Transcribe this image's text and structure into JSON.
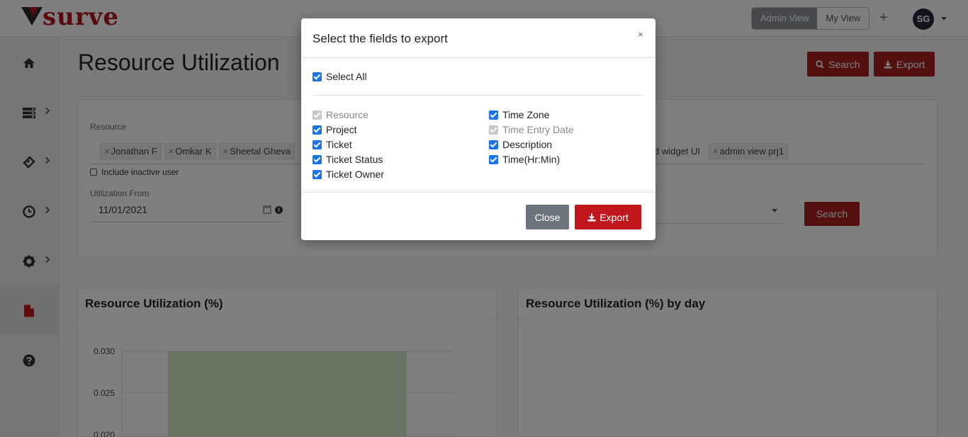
{
  "header": {
    "logo_text": "surve",
    "view_toggle": {
      "admin": "Admin View",
      "my": "My View"
    },
    "plus": "+",
    "avatar_initials": "SG"
  },
  "page": {
    "title": "Resource Utilization",
    "search_label": "Search",
    "export_label": "Export"
  },
  "filters": {
    "resource_label": "Resource",
    "resource_chips": [
      "Jonathan F",
      "Omkar K",
      "Sheetal Gheva"
    ],
    "project_chips": [
      "d widget UI",
      "admin view prj1"
    ],
    "include_inactive_label": "Include inactive user",
    "utilization_from_label": "Utilization From",
    "utilization_from_value": "11/01/2021",
    "search_button": "Search"
  },
  "charts": {
    "left_title": "Resource Utilization (%)",
    "right_title": "Resource Utilization (%) by day"
  },
  "chart_data": {
    "type": "bar",
    "title": "Resource Utilization (%)",
    "categories": [
      ""
    ],
    "values": [
      0.03
    ],
    "ylim": [
      0.02,
      0.03
    ],
    "yticks": [
      "0.030",
      "0.025",
      "0.020"
    ],
    "bar_color": "#d3e9c0",
    "grid": true
  },
  "modal": {
    "title": "Select the fields to export",
    "close_x": "×",
    "select_all": "Select All",
    "fields_left": [
      {
        "label": "Resource",
        "disabled": true
      },
      {
        "label": "Project",
        "disabled": false
      },
      {
        "label": "Ticket",
        "disabled": false
      },
      {
        "label": "Ticket Status",
        "disabled": false
      },
      {
        "label": "Ticket Owner",
        "disabled": false
      }
    ],
    "fields_right": [
      {
        "label": "Time Zone",
        "disabled": false
      },
      {
        "label": "Time Entry Date",
        "disabled": true
      },
      {
        "label": "Description",
        "disabled": false
      },
      {
        "label": "Time(Hr:Min)",
        "disabled": false
      }
    ],
    "close_button": "Close",
    "export_button": "Export"
  },
  "colors": {
    "brand_red": "#b3141a",
    "checkbox_blue": "#1a73e8",
    "overlay": "rgba(0,0,0,0.5)"
  }
}
